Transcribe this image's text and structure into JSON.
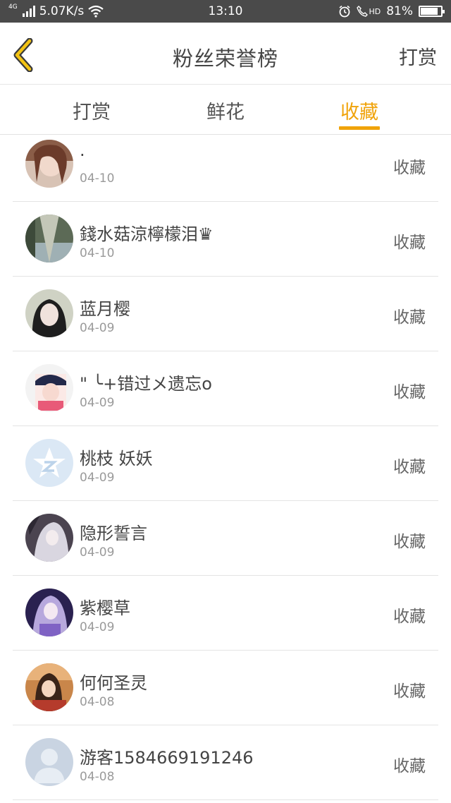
{
  "status_bar": {
    "network_label": "4G",
    "speed": "5.07K/s",
    "time": "13:10",
    "hd_label": "HD",
    "battery": "81%",
    "battery_level": 0.81
  },
  "header": {
    "back_icon": "chevron-left-icon",
    "title": "粉丝荣誉榜",
    "action": "打赏",
    "accent_color": "#f0a30a"
  },
  "tabs": [
    {
      "label": "打赏",
      "active": false
    },
    {
      "label": "鲜花",
      "active": false
    },
    {
      "label": "收藏",
      "active": true
    }
  ],
  "list": [
    {
      "name": "·",
      "date": "04-10",
      "action": "收藏"
    },
    {
      "name": "錢水菇涼檸檬泪♛",
      "date": "04-10",
      "action": "收藏"
    },
    {
      "name": "蓝月樱",
      "date": "04-09",
      "action": "收藏"
    },
    {
      "name": "\"  ╰+错过メ遗忘o",
      "date": "04-09",
      "action": "收藏"
    },
    {
      "name": "桃枝 妖妖",
      "date": "04-09",
      "action": "收藏"
    },
    {
      "name": "隐形誓言",
      "date": "04-09",
      "action": "收藏"
    },
    {
      "name": "紫樱草",
      "date": "04-09",
      "action": "收藏"
    },
    {
      "name": "何何圣灵",
      "date": "04-08",
      "action": "收藏"
    },
    {
      "name": "游客1584669191246",
      "date": "04-08",
      "action": "收藏"
    }
  ]
}
